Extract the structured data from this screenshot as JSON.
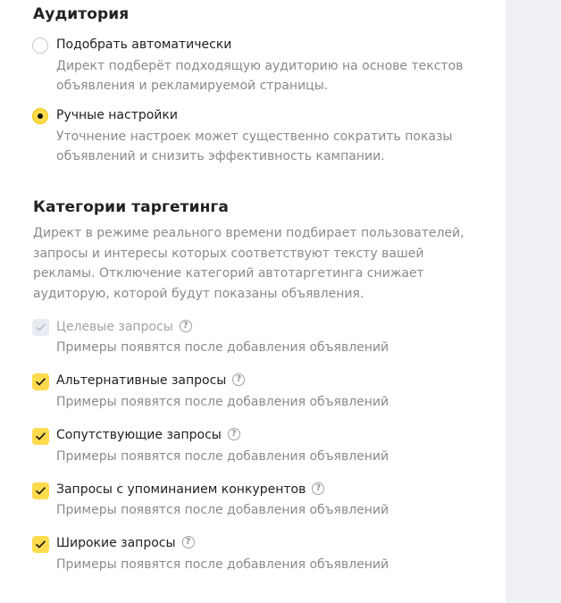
{
  "audience": {
    "title": "Аудитория",
    "options": [
      {
        "label": "Подобрать автоматически",
        "description": "Директ подберёт подходящую аудиторию на основе текстов объявления и рекламируемой страницы.",
        "checked": false
      },
      {
        "label": "Ручные настройки",
        "description": "Уточнение настроек может существенно сократить показы объявлений и снизить эффективность кампании.",
        "checked": true
      }
    ]
  },
  "targeting": {
    "title": "Категории таргетинга",
    "description": "Директ в режиме реального времени подбирает пользователей, запросы и интересы которых соответствуют тексту вашей рекламы. Отключение категорий автотаргетинга снижает аудиторую, которой будут показаны объявления.",
    "help_icon": "?",
    "categories": [
      {
        "label": "Целевые запросы",
        "hint": "Примеры появятся после добавления объявлений",
        "checked": true,
        "disabled": true
      },
      {
        "label": "Альтернативные запросы",
        "hint": "Примеры появятся после добавления объявлений",
        "checked": true,
        "disabled": false
      },
      {
        "label": "Сопутствующие запросы",
        "hint": "Примеры появятся после добавления объявлений",
        "checked": true,
        "disabled": false
      },
      {
        "label": "Запросы с упоминанием конкурентов",
        "hint": "Примеры появятся после добавления объявлений",
        "checked": true,
        "disabled": false
      },
      {
        "label": "Широкие запросы",
        "hint": "Примеры появятся после добавления объявлений",
        "checked": true,
        "disabled": false
      }
    ]
  },
  "colors": {
    "accent_yellow": "#ffdb4d",
    "disabled_checkbox": "#e8ebf0",
    "muted_text": "#8a8a8a",
    "side_background": "#eff1f5"
  }
}
